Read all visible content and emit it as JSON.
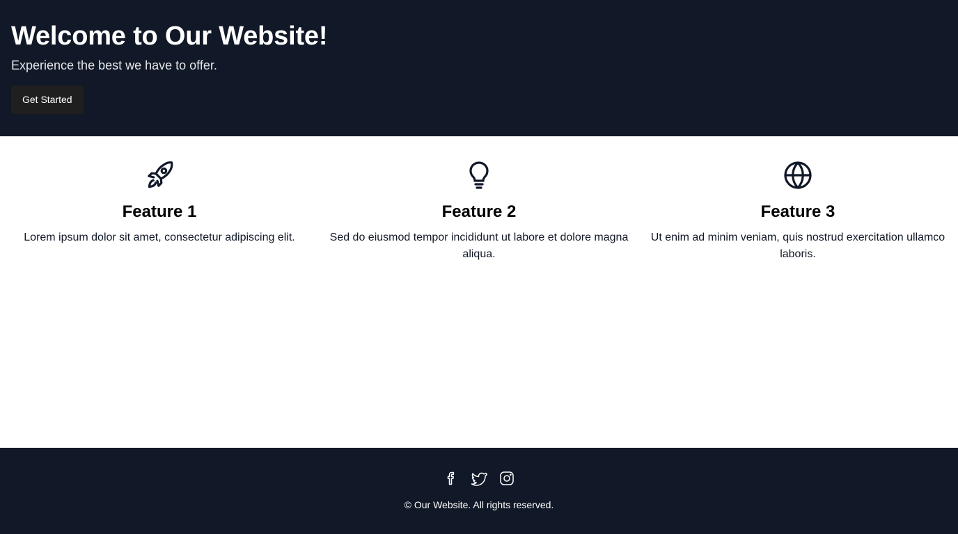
{
  "hero": {
    "title": "Welcome to Our Website!",
    "subtitle": "Experience the best we have to offer.",
    "cta_label": "Get Started",
    "background_color": "#111827"
  },
  "features": [
    {
      "icon": "rocket-icon",
      "title": "Feature 1",
      "description": "Lorem ipsum dolor sit amet, consectetur adipiscing elit."
    },
    {
      "icon": "lightbulb-icon",
      "title": "Feature 2",
      "description": "Sed do eiusmod tempor incididunt ut labore et dolore magna aliqua."
    },
    {
      "icon": "globe-icon",
      "title": "Feature 3",
      "description": "Ut enim ad minim veniam, quis nostrud exercitation ullamco laboris."
    }
  ],
  "footer": {
    "social_icons": [
      "facebook-icon",
      "twitter-icon",
      "instagram-icon"
    ],
    "copyright": "© Our Website. All rights reserved."
  }
}
